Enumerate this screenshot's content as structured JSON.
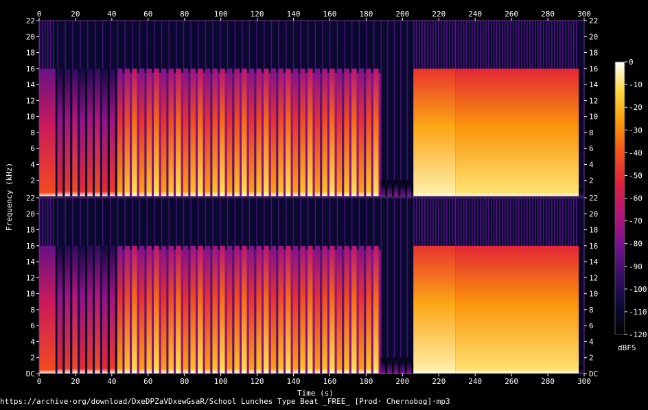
{
  "chart_data": {
    "type": "heatmap",
    "xlabel": "Time (s)",
    "ylabel": "Frequency (kHz)",
    "x_ticks": [
      "0",
      "20",
      "40",
      "60",
      "80",
      "100",
      "120",
      "140",
      "160",
      "180",
      "200",
      "220",
      "240",
      "260",
      "280",
      "300"
    ],
    "y_ticks_top": [
      "22",
      "20",
      "18",
      "16",
      "14",
      "12",
      "10",
      "8",
      "6",
      "4",
      "2"
    ],
    "y_ticks_bottom": [
      "22",
      "20",
      "18",
      "16",
      "14",
      "12",
      "10",
      "8",
      "6",
      "4",
      "2",
      "DC"
    ],
    "xlim": [
      0,
      300
    ],
    "ylim_khz": [
      0,
      22
    ],
    "channels": 2,
    "colorbar": {
      "ticks": [
        "0",
        "-10",
        "-20",
        "-30",
        "-40",
        "-50",
        "-60",
        "-70",
        "-80",
        "-90",
        "-100",
        "-110",
        "-120"
      ],
      "range_dbfs": [
        -120,
        0
      ],
      "unit": "dBFS",
      "colors": [
        "#000000",
        "#0d0a3a",
        "#3a0d6b",
        "#7a1290",
        "#b5147a",
        "#e0203a",
        "#f5521a",
        "#fb9a0a",
        "#ffd63a",
        "#ffffff"
      ]
    },
    "segments": [
      {
        "start": 0,
        "end": 9,
        "intensity": 0.55,
        "cutoff_khz": 16,
        "pulse": false
      },
      {
        "start": 9,
        "end": 10,
        "intensity": 0.0,
        "cutoff_khz": 0,
        "pulse": false
      },
      {
        "start": 10,
        "end": 43,
        "intensity": 0.5,
        "cutoff_khz": 16,
        "pulse": true
      },
      {
        "start": 43,
        "end": 188,
        "intensity": 0.75,
        "cutoff_khz": 16,
        "pulse": true
      },
      {
        "start": 188,
        "end": 206,
        "intensity": 0.2,
        "cutoff_khz": 2,
        "pulse": true
      },
      {
        "start": 206,
        "end": 229,
        "intensity": 0.85,
        "cutoff_khz": 16,
        "pulse": false
      },
      {
        "start": 229,
        "end": 297,
        "intensity": 0.82,
        "cutoff_khz": 16,
        "pulse": false
      },
      {
        "start": 297,
        "end": 300,
        "intensity": 0.1,
        "cutoff_khz": 1,
        "pulse": false
      }
    ]
  },
  "footer": {
    "source_url": "https://archive·org/download/DxeDPZaVDxewGsaR/School Lunches Type Beat _FREE_ [Prod· Chernobog]·mp3"
  }
}
